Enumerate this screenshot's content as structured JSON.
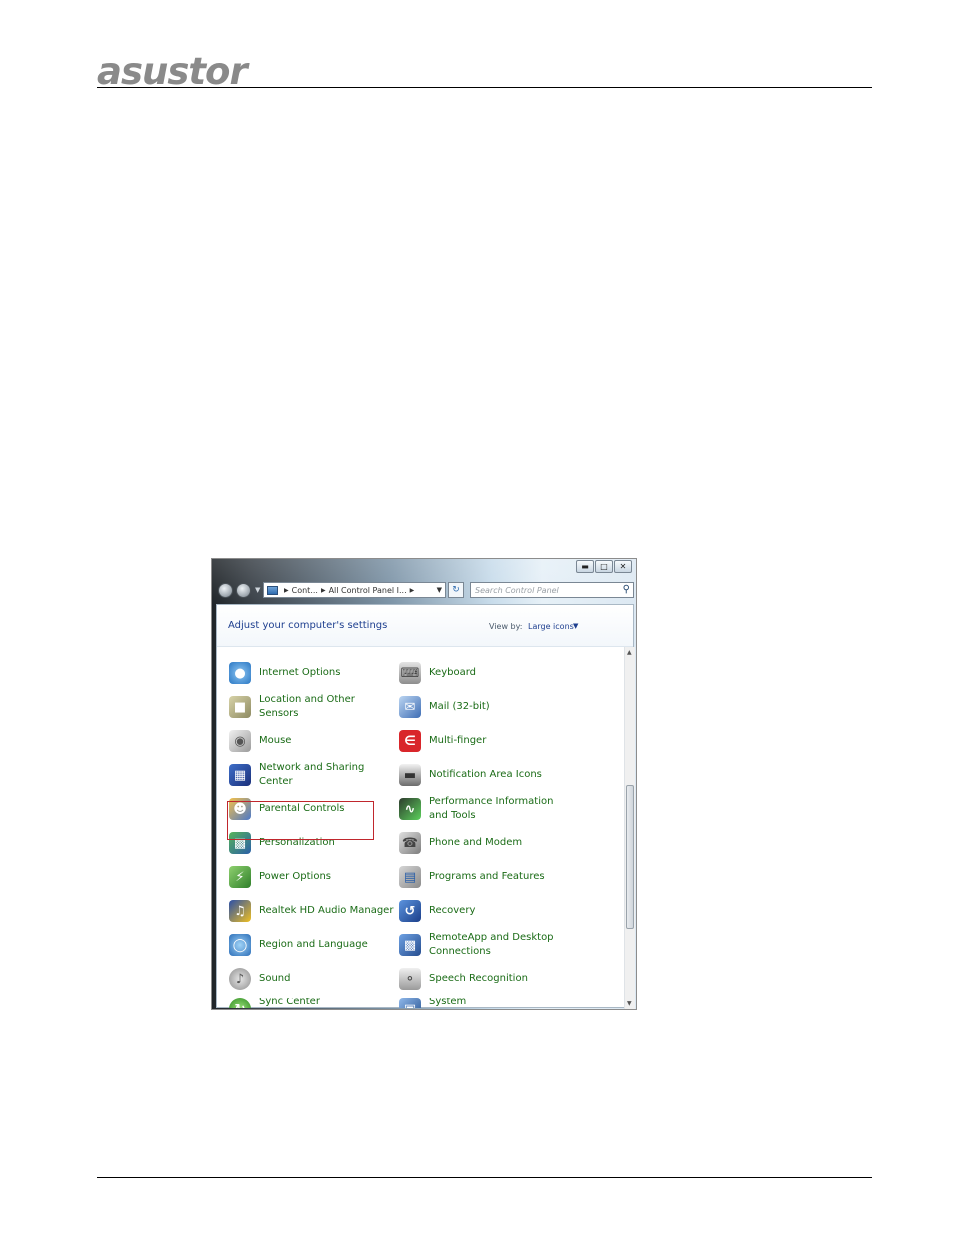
{
  "document": {
    "logo_text": "asustor"
  },
  "window": {
    "caption_buttons": [
      "minimize-icon",
      "maximize-icon",
      "close-icon"
    ],
    "address": {
      "segments": [
        "Cont...",
        "All Control Panel I..."
      ]
    },
    "search_placeholder": "Search Control Panel",
    "header": {
      "title": "Adjust your computer's settings",
      "view_by_label": "View by:",
      "view_by_value": "Large icons"
    },
    "items_left": [
      {
        "label": "Internet Options",
        "icon": "internet-options-icon"
      },
      {
        "label": "Location and Other Sensors",
        "icon": "location-sensors-icon"
      },
      {
        "label": "Mouse",
        "icon": "mouse-icon"
      },
      {
        "label": "Network and Sharing Center",
        "icon": "network-sharing-icon"
      },
      {
        "label": "Parental Controls",
        "icon": "parental-controls-icon"
      },
      {
        "label": "Personalization",
        "icon": "personalization-icon"
      },
      {
        "label": "Power Options",
        "icon": "power-options-icon"
      },
      {
        "label": "Realtek HD Audio Manager",
        "icon": "realtek-audio-icon"
      },
      {
        "label": "Region and Language",
        "icon": "region-language-icon"
      },
      {
        "label": "Sound",
        "icon": "sound-icon"
      },
      {
        "label": "Sync Center",
        "icon": "sync-center-icon"
      }
    ],
    "items_right": [
      {
        "label": "Keyboard",
        "icon": "keyboard-icon"
      },
      {
        "label": "Mail (32-bit)",
        "icon": "mail-icon"
      },
      {
        "label": "Multi-finger",
        "icon": "multi-finger-icon"
      },
      {
        "label": "Notification Area Icons",
        "icon": "notification-area-icon"
      },
      {
        "label": "Performance Information and Tools",
        "icon": "performance-icon"
      },
      {
        "label": "Phone and Modem",
        "icon": "phone-modem-icon"
      },
      {
        "label": "Programs and Features",
        "icon": "programs-features-icon"
      },
      {
        "label": "Recovery",
        "icon": "recovery-icon"
      },
      {
        "label": "RemoteApp and Desktop Connections",
        "icon": "remoteapp-icon"
      },
      {
        "label": "Speech Recognition",
        "icon": "speech-recognition-icon"
      },
      {
        "label": "System",
        "icon": "system-icon"
      }
    ],
    "highlight_color": "#c0272d",
    "link_color": "#1a6b16"
  }
}
